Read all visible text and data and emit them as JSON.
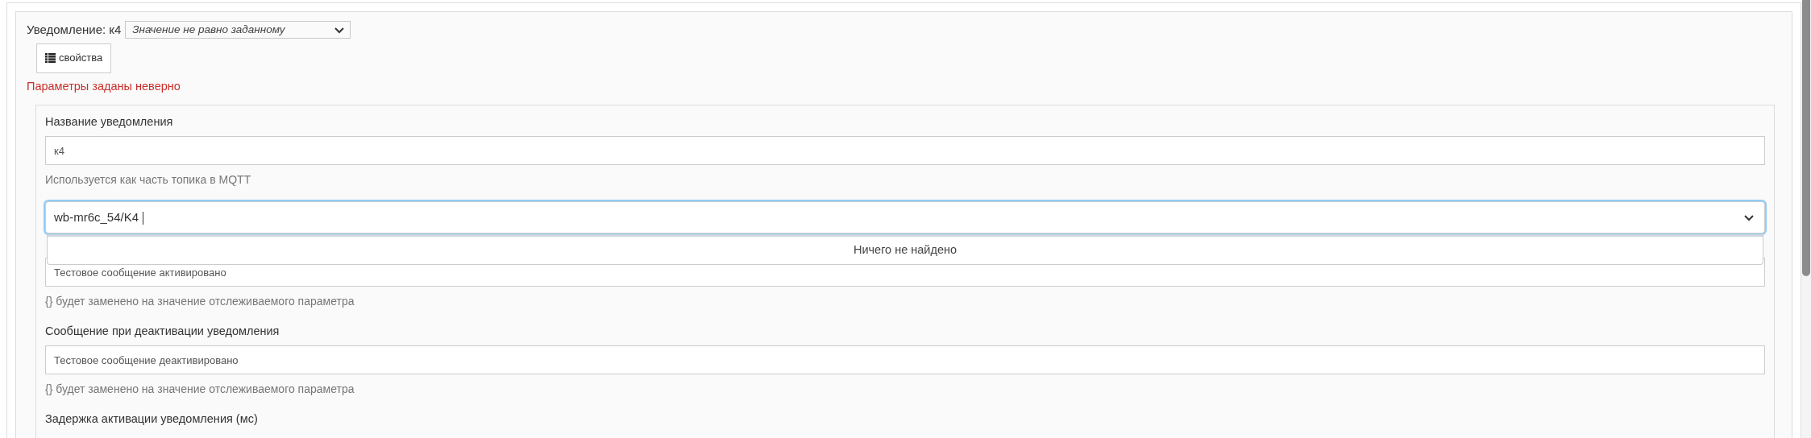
{
  "notification": {
    "title": "Уведомление: к4",
    "condition": {
      "value": "Значение не равно заданному"
    },
    "properties_button": "свойства",
    "error": "Параметры заданы неверно"
  },
  "fields": [
    {
      "kind": "text",
      "label": "Название уведомления",
      "value": "к4",
      "help": "Используется как часть топика в MQTT"
    },
    {
      "kind": "combo",
      "value": "wb-mr6c_54/K4",
      "focused": true,
      "dropdown": {
        "message": "Ничего не найдено"
      }
    },
    {
      "kind": "text",
      "value": "Тестовое сообщение активировано",
      "help": "{} будет заменено на значение отслеживаемого параметра"
    },
    {
      "kind": "text",
      "label": "Сообщение при деактивации уведомления",
      "value": "Тестовое сообщение деактивировано",
      "help": "{} будет заменено на значение отслеживаемого параметра"
    },
    {
      "kind": "text",
      "label": "Задержка активации уведомления (мс)"
    }
  ]
}
